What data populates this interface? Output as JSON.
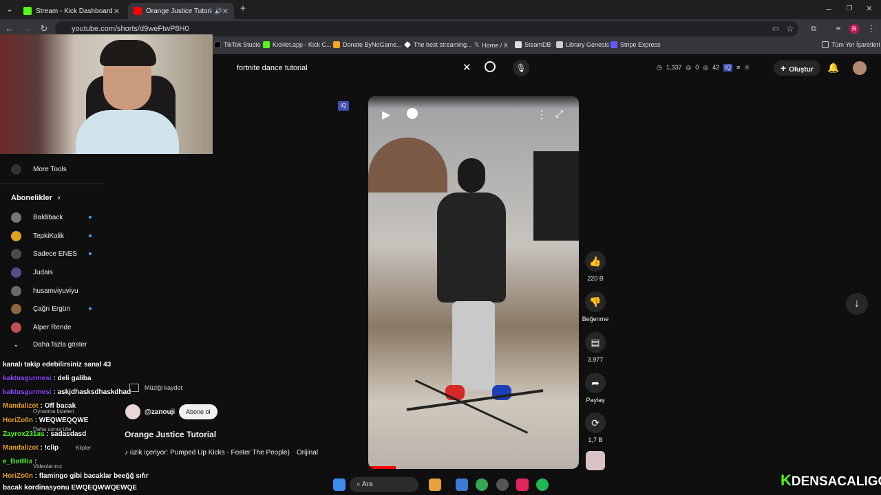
{
  "tabs": [
    {
      "label": "Stream - Kick Dashboard"
    },
    {
      "label": "Orange Justice Tutorial - Yo"
    }
  ],
  "url": "youtube.com/shorts/d9weFtwP8H0",
  "bookmarks": [
    "TikTok Studio",
    "Kicklet.app - Kick C...",
    "Donate ByNoGame...",
    "The best streaming...",
    "Home / X",
    "SteamDB",
    "Library Genesis",
    "Stripe Express"
  ],
  "bookmarks_all": "Tüm Yer İşaretleri",
  "search": {
    "value": "fortnite dance tutorial"
  },
  "header": {
    "stat1": "1,337",
    "stat2": "0",
    "stat3": "42",
    "create_label": "Oluştur"
  },
  "sidebar": {
    "more_tools": "More Tools",
    "subs_title": "Abonelikler",
    "items": [
      {
        "label": "Baldiback",
        "color": "#777777"
      },
      {
        "label": "TepkiKolik",
        "color": "#e0a321"
      },
      {
        "label": "Sadece ENES",
        "color": "#4a4a4a"
      },
      {
        "label": "Judais",
        "color": "#5a4a8a"
      },
      {
        "label": "husamviyuviyu",
        "color": "#6a6a6a"
      },
      {
        "label": "Çağrı Ergün",
        "color": "#8a6a3a"
      },
      {
        "label": "Alper Rende",
        "color": "#c05050"
      }
    ],
    "show_more": "Daha fazla göster"
  },
  "short": {
    "channel": "@zanouji",
    "subscribe": "Abone ol",
    "title": "Orange Justice Tutorial",
    "music": "üzik içeriyor: Pumped Up Kicks · Foster The People)",
    "original": "Orijinal",
    "save_music": "Müziği kaydet"
  },
  "actions": {
    "likes": "220 B",
    "dislike": "Beğenme",
    "comments": "3.977",
    "share": "Paylaş",
    "remix": "1,7 B"
  },
  "overlay_menu": [
    "Oynatma listeleri",
    "Daha sonra izle",
    "Klipler",
    "Videolarınız"
  ],
  "chat": [
    {
      "user": "",
      "msg": "kanalı takip edebilirsiniz sanal 43",
      "color": "#ffffff"
    },
    {
      "user": "kaktusgurmesi",
      "msg": "deli galiba",
      "color": "#9146ff"
    },
    {
      "user": "kaktusgurmesi",
      "msg": "askjdhasksdhaskdhad",
      "color": "#9146ff"
    },
    {
      "user": "Mandalizot",
      "msg": "Off bacak",
      "color": "#e8a317"
    },
    {
      "user": "HoriZo0n",
      "msg": "WEQWEQQWE",
      "color": "#e8a317"
    },
    {
      "user": "Zayrox231as",
      "msg": "sadasdasd",
      "color": "#53fc18"
    },
    {
      "user": "Mandalizot",
      "msg": "!clip",
      "color": "#e8a317"
    },
    {
      "user": "e_BotRix",
      "msg": "",
      "color": "#53fc18"
    },
    {
      "user": "HoriZo0n",
      "msg": "flamingo gibi bacaklar beeğğ sıfır",
      "color": "#e8a317"
    },
    {
      "user": "",
      "msg": "bacak kordinasyonu EWQEQWWQEWQE",
      "color": "#ffffff"
    }
  ],
  "taskbar": {
    "search_label": "Ara"
  },
  "watermark": "DENSACALIGO",
  "colors": {
    "accent": "#3ea6ff",
    "kick": "#53fc18",
    "yt_red": "#ff0000"
  }
}
